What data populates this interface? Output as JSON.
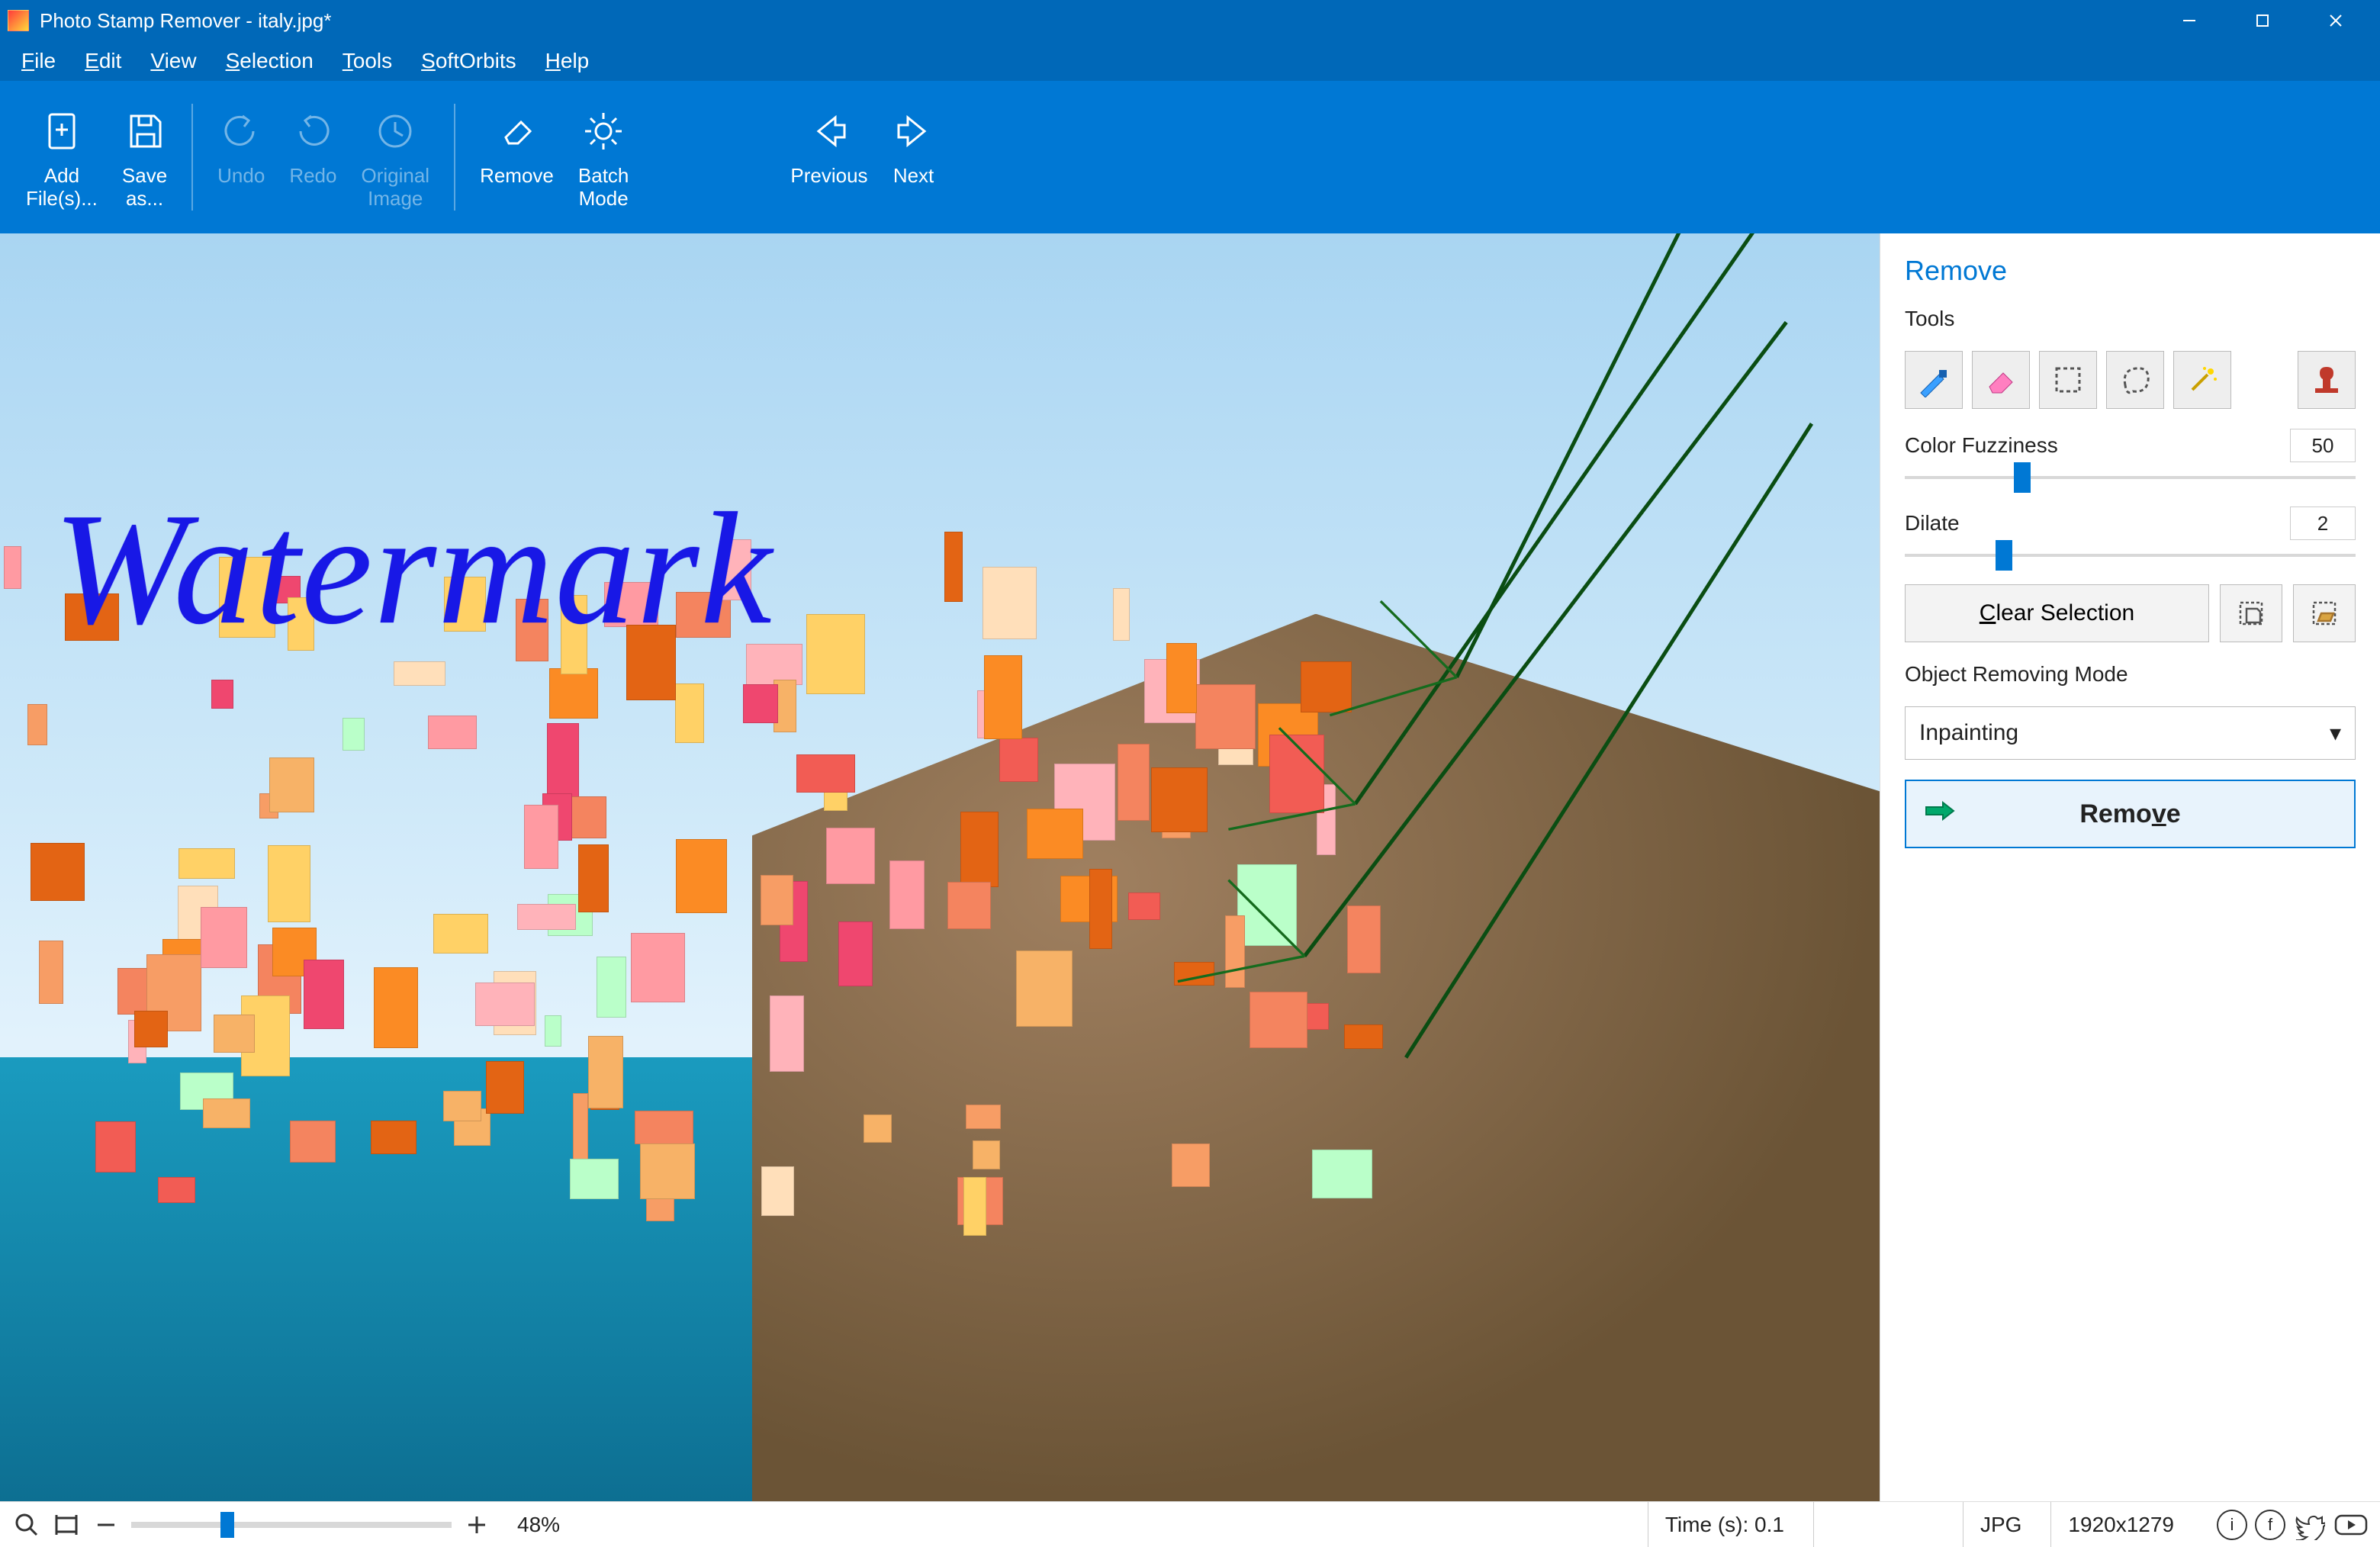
{
  "title": "Photo Stamp Remover - italy.jpg*",
  "menus": [
    "File",
    "Edit",
    "View",
    "Selection",
    "Tools",
    "SoftOrbits",
    "Help"
  ],
  "toolbar": {
    "add": "Add\nFile(s)...",
    "save": "Save\nas...",
    "undo": "Undo",
    "redo": "Redo",
    "orig": "Original\nImage",
    "remove": "Remove",
    "batch": "Batch\nMode",
    "prev": "Previous",
    "next": "Next"
  },
  "watermark": "Watermark",
  "panel": {
    "heading": "Remove",
    "tools_label": "Tools",
    "fuzz_label": "Color Fuzziness",
    "fuzz_value": "50",
    "fuzz_pct": 26,
    "dilate_label": "Dilate",
    "dilate_value": "2",
    "dilate_pct": 22,
    "clear": "Clear Selection",
    "mode_label": "Object Removing Mode",
    "mode_value": "Inpainting",
    "remove_btn": "Remove"
  },
  "status": {
    "zoom_pct": 30,
    "zoom_label": "48%",
    "time": "Time (s): 0.1",
    "format": "JPG",
    "dims": "1920x1279"
  }
}
